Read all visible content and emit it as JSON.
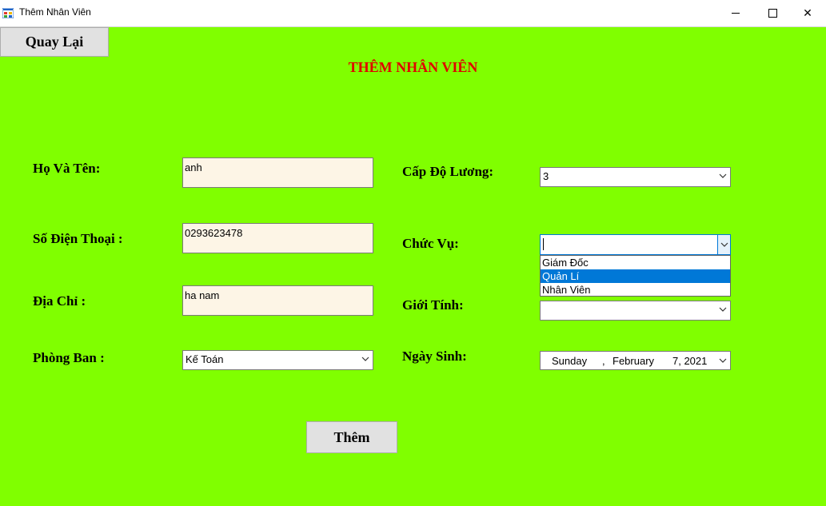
{
  "window": {
    "title": "Thêm Nhân Viên",
    "controls": {
      "minimize": "—",
      "close": "✕"
    }
  },
  "back_button_label": "Quay Lại",
  "page_title": "THÊM NHÂN VIÊN",
  "labels": {
    "full_name": "Họ Và Tên:",
    "phone": "Số Điện Thoại :",
    "address": "Địa Chỉ :",
    "department": "Phòng Ban :",
    "salary_level": "Cấp Độ Lương:",
    "position": "Chức Vụ:",
    "gender": "Giới Tính:",
    "birth_date": "Ngày Sinh:"
  },
  "fields": {
    "full_name": "anh",
    "phone": "0293623478",
    "address": "ha nam",
    "department": "Kế Toán",
    "salary_level": "3",
    "position": "",
    "gender": "",
    "birth_date": {
      "weekday": "Sunday",
      "sep": ",",
      "month": "February",
      "day_year": "7, 2021"
    }
  },
  "position_options": [
    {
      "label": "Giám Đốc",
      "selected": false
    },
    {
      "label": "Quản Lí",
      "selected": true
    },
    {
      "label": "Nhân Viên",
      "selected": false
    }
  ],
  "add_button_label": "Thêm",
  "colors": {
    "background": "#80ff00",
    "title": "#e00000",
    "textbox_bg": "#fdf5e6",
    "selection": "#0078d7"
  }
}
